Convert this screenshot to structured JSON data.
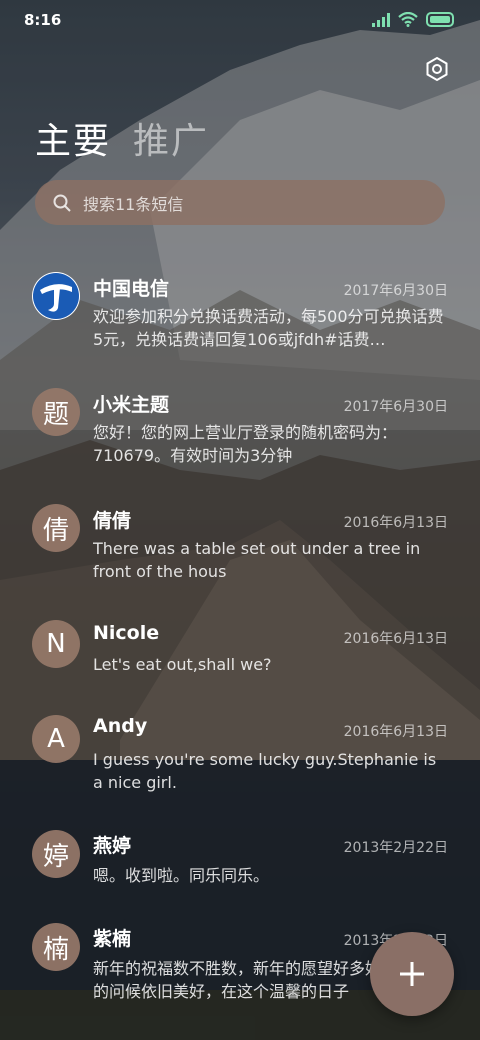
{
  "status_bar": {
    "time": "8:16"
  },
  "tabs": [
    {
      "label": "主要"
    },
    {
      "label": "推广"
    }
  ],
  "search": {
    "placeholder": "搜索11条短信"
  },
  "conversations": [
    {
      "avatar": "",
      "avatar_type": "logo",
      "name": "中国电信",
      "date": "2017年6月30日",
      "preview": "欢迎参加积分兑换话费活动，每500分可兑换话费5元，兑换话费请回复106或jfdh#话费…"
    },
    {
      "avatar": "题",
      "name": "小米主题",
      "date": "2017年6月30日",
      "preview": "您好！您的网上营业厅登录的随机密码为：710679。有效时间为3分钟"
    },
    {
      "avatar": "倩",
      "name": "倩倩",
      "date": "2016年6月13日",
      "preview": "There was a table set out under a tree in front of the hous"
    },
    {
      "avatar": "N",
      "name": "Nicole",
      "date": "2016年6月13日",
      "preview": "Let's eat out,shall we?"
    },
    {
      "avatar": "A",
      "name": "Andy",
      "date": "2016年6月13日",
      "preview": "I guess you're some lucky guy.Stephanie is a nice girl."
    },
    {
      "avatar": "婷",
      "name": "燕婷",
      "date": "2013年2月22日",
      "preview": "嗯。收到啦。同乐同乐。"
    },
    {
      "avatar": "楠",
      "name": "紫楠",
      "date": "2013年2月22日",
      "preview": "新年的祝福数不胜数，新年的愿望好多好多，新年的问候依旧美好，在这个温馨的日子"
    }
  ],
  "colors": {
    "accent": "#8a6f66",
    "avatar_bg": "#96786a",
    "telecom_blue": "#1a5bb5"
  },
  "icons": {
    "settings": "hexagon-gear-icon",
    "search": "search-icon",
    "fab": "plus-icon"
  }
}
